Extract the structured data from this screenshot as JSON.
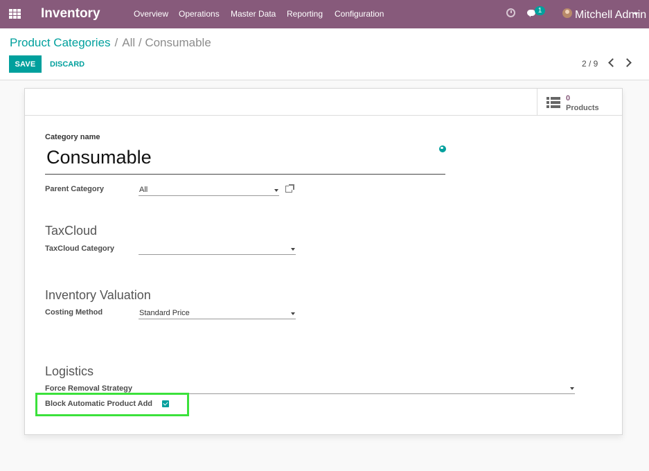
{
  "navbar": {
    "app_title": "Inventory",
    "menu": [
      "Overview",
      "Operations",
      "Master Data",
      "Reporting",
      "Configuration"
    ],
    "chat_badge": "1",
    "user_name": "Mitchell Admin"
  },
  "control_panel": {
    "breadcrumb_link": "Product Categories",
    "breadcrumb_separator": "/",
    "breadcrumb_current": "All / Consumable",
    "save_label": "SAVE",
    "discard_label": "DISCARD",
    "pager_value": "2 / 9"
  },
  "stat_button": {
    "value": "0",
    "label": "Products"
  },
  "form": {
    "category_name_label": "Category name",
    "category_name_value": "Consumable",
    "parent_category_label": "Parent Category",
    "parent_category_value": "All",
    "taxcloud_section": "TaxCloud",
    "taxcloud_category_label": "TaxCloud Category",
    "taxcloud_category_value": "",
    "inventory_valuation_section": "Inventory Valuation",
    "costing_method_label": "Costing Method",
    "costing_method_value": "Standard Price",
    "logistics_section": "Logistics",
    "force_removal_label": "Force Removal Strategy",
    "force_removal_value": "",
    "block_product_add_label": "Block Automatic Product Add",
    "block_product_add_checked": true
  },
  "colors": {
    "navbar": "#875a7b",
    "accent": "#00a09d",
    "highlight": "#3be13b"
  }
}
